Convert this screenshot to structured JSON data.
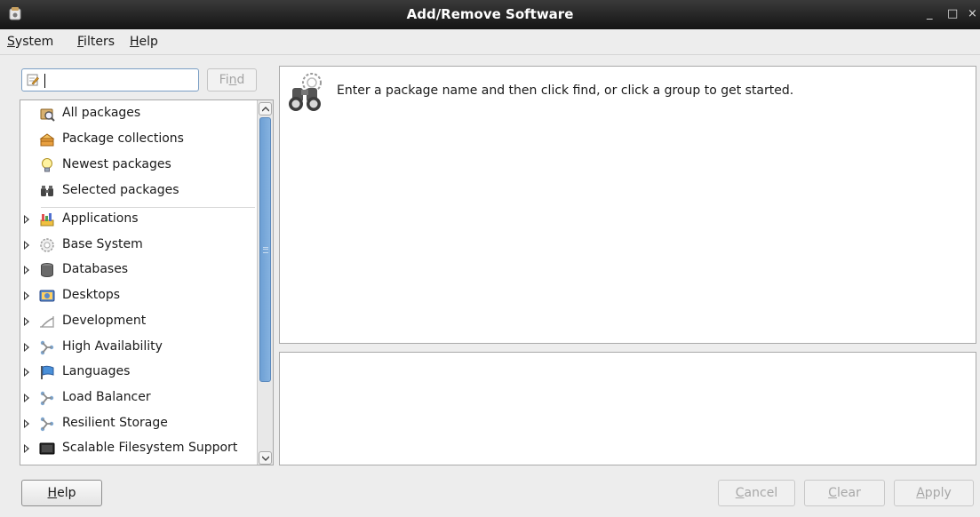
{
  "window": {
    "title": "Add/Remove Software",
    "minimize": "_",
    "maximize": "□",
    "close": "×"
  },
  "menu": [
    "System",
    "Filters",
    "Help"
  ],
  "search": {
    "value": "",
    "find_label": "Find"
  },
  "groups_special": [
    {
      "label": "All packages",
      "icon": "all-packages-icon"
    },
    {
      "label": "Package collections",
      "icon": "package-collections-icon"
    },
    {
      "label": "Newest packages",
      "icon": "newest-packages-icon"
    },
    {
      "label": "Selected packages",
      "icon": "selected-packages-icon"
    }
  ],
  "groups": [
    {
      "label": "Applications",
      "icon": "applications-icon"
    },
    {
      "label": "Base System",
      "icon": "base-system-icon"
    },
    {
      "label": "Databases",
      "icon": "databases-icon"
    },
    {
      "label": "Desktops",
      "icon": "desktops-icon"
    },
    {
      "label": "Development",
      "icon": "development-icon"
    },
    {
      "label": "High Availability",
      "icon": "high-availability-icon"
    },
    {
      "label": "Languages",
      "icon": "languages-icon"
    },
    {
      "label": "Load Balancer",
      "icon": "load-balancer-icon"
    },
    {
      "label": "Resilient Storage",
      "icon": "resilient-storage-icon"
    },
    {
      "label": "Scalable Filesystem Support",
      "icon": "scalable-filesystem-icon"
    }
  ],
  "info": {
    "message": "Enter a package name and then click find, or click a group to get started."
  },
  "buttons": {
    "help": "Help",
    "cancel": "Cancel",
    "clear": "Clear",
    "apply": "Apply"
  },
  "colors": {
    "titlebar": "#1e1e1e",
    "scroll_thumb": "#76a8db",
    "background": "#ededed"
  }
}
